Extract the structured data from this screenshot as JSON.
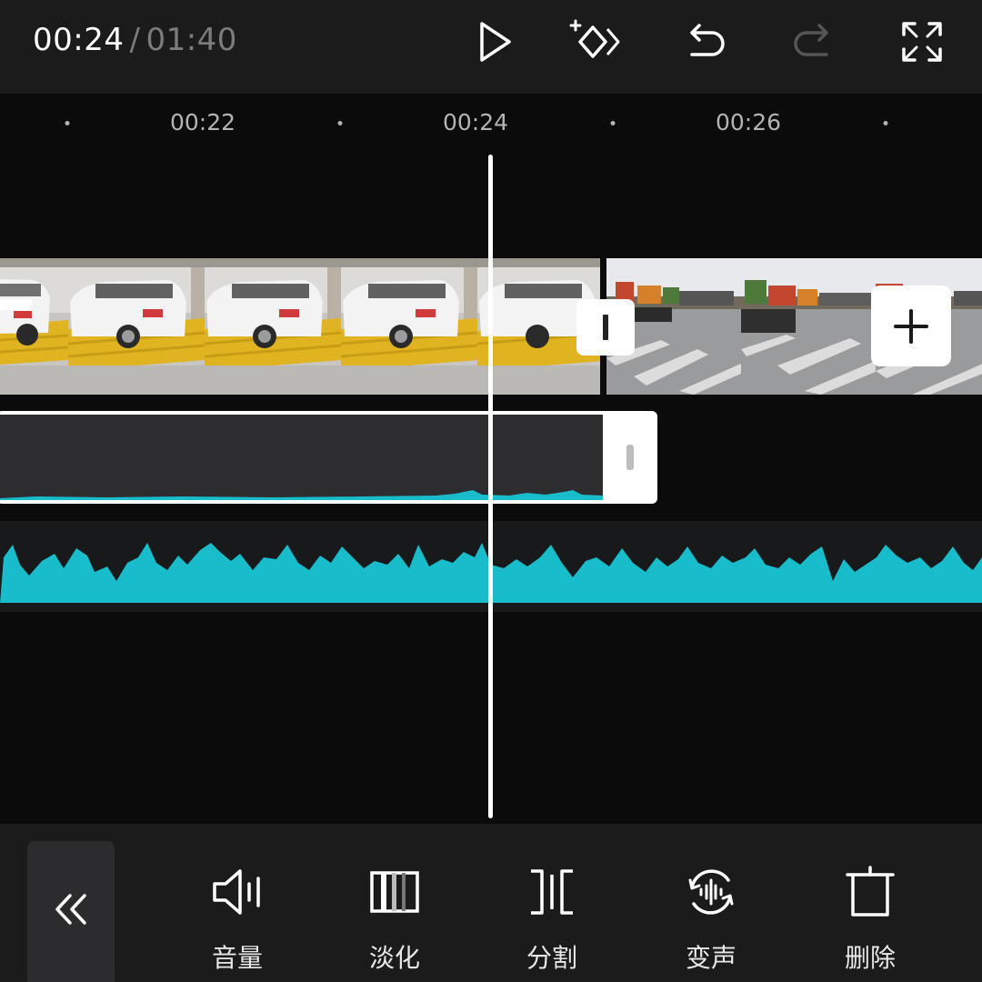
{
  "header": {
    "current_time": "00:24",
    "separator": "/",
    "total_time": "01:40",
    "play_icon": "play-icon",
    "keyframe_icon": "add-keyframe-icon",
    "undo_icon": "undo-icon",
    "redo_icon": "redo-icon",
    "fullscreen_icon": "fullscreen-icon"
  },
  "ruler": {
    "labels": [
      "00:22",
      "00:24",
      "00:26"
    ]
  },
  "timeline": {
    "video_clips": [
      "car-wash-clip",
      "road-crossing-clip"
    ],
    "transition_icon": "transition-icon",
    "add_clip_icon": "plus-icon"
  },
  "toolbar": {
    "collapse_icon": "double-chevron-left-icon",
    "tools": [
      {
        "label": "音量",
        "icon": "volume-icon"
      },
      {
        "label": "淡化",
        "icon": "fade-icon"
      },
      {
        "label": "分割",
        "icon": "split-icon"
      },
      {
        "label": "变声",
        "icon": "voice-change-icon"
      },
      {
        "label": "删除",
        "icon": "delete-icon"
      }
    ]
  },
  "colors": {
    "accent_waveform": "#19bccb",
    "background": "#0b0b0c",
    "bar": "#1b1b1c"
  }
}
